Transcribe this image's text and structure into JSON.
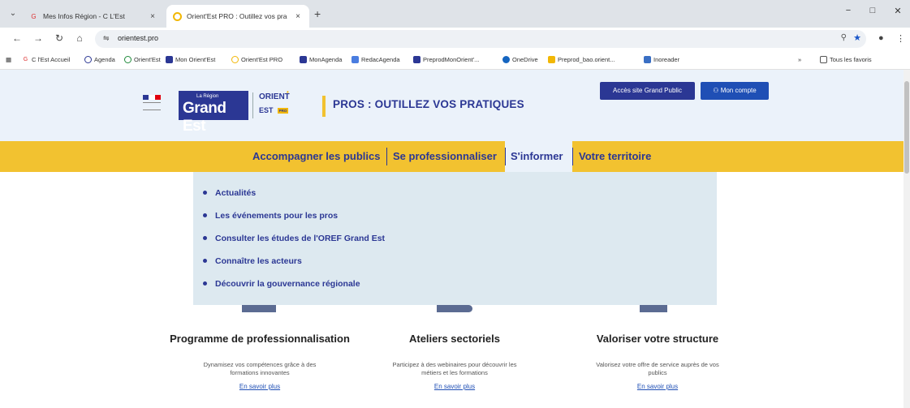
{
  "browser": {
    "tabs": [
      {
        "title": "Mes Infos Région - C L'Est",
        "active": false
      },
      {
        "title": "Orient'Est PRO : Outillez vos pra",
        "active": true
      }
    ],
    "new_tab": "+",
    "close": "×",
    "minimize": "−",
    "maximize": "□",
    "close_window": "✕",
    "url": "orientest.pro",
    "bookmarks": [
      "C l'Est Accueil",
      "Agenda",
      "Orient'Est",
      "Mon Orient'Est",
      "Orient'Est PRO",
      "MonAgenda",
      "RedacAgenda",
      "PreprodMonOrient'...",
      "OneDrive",
      "Preprod_bao.orient...",
      "Inoreader"
    ],
    "bookmarks_more": "»",
    "all_bookmarks": "Tous les favoris"
  },
  "header": {
    "region_top": "La Région",
    "region_name": "Grand Est",
    "oe_line1": "ORIENT",
    "oe_line2": "EST",
    "oe_badge": "PRO",
    "tagline": "PROS : OUTILLEZ VOS PRATIQUES",
    "btn_public": "Accès site Grand Public",
    "btn_account": "Mon compte"
  },
  "nav": {
    "items": [
      "Accompagner les publics",
      "Se professionnaliser",
      "S'informer",
      "Votre territoire"
    ],
    "active_index": 2
  },
  "dropdown": {
    "items": [
      "Actualités",
      "Les événements pour les pros",
      "Consulter les études de l'OREF Grand Est",
      "Connaître les acteurs",
      "Découvrir la gouvernance régionale"
    ]
  },
  "cards": [
    {
      "title": "Programme de professionnalisation",
      "desc1": "Dynamisez vos compétences grâce à des",
      "desc2": "formations innovantes",
      "link": "En savoir plus"
    },
    {
      "title": "Ateliers sectoriels",
      "desc1": "Participez à des webinaires pour découvrir les",
      "desc2": "métiers et les formations",
      "link": "En savoir plus"
    },
    {
      "title": "Valoriser votre structure",
      "desc1": "Valorisez votre offre de service auprès de vos",
      "desc2": "publics",
      "link": "En savoir plus"
    }
  ],
  "colors": {
    "brand_blue": "#2b3794",
    "accent_yellow": "#f2c230",
    "header_bg": "#ebf2fa",
    "dropdown_bg": "#dde9f0"
  }
}
